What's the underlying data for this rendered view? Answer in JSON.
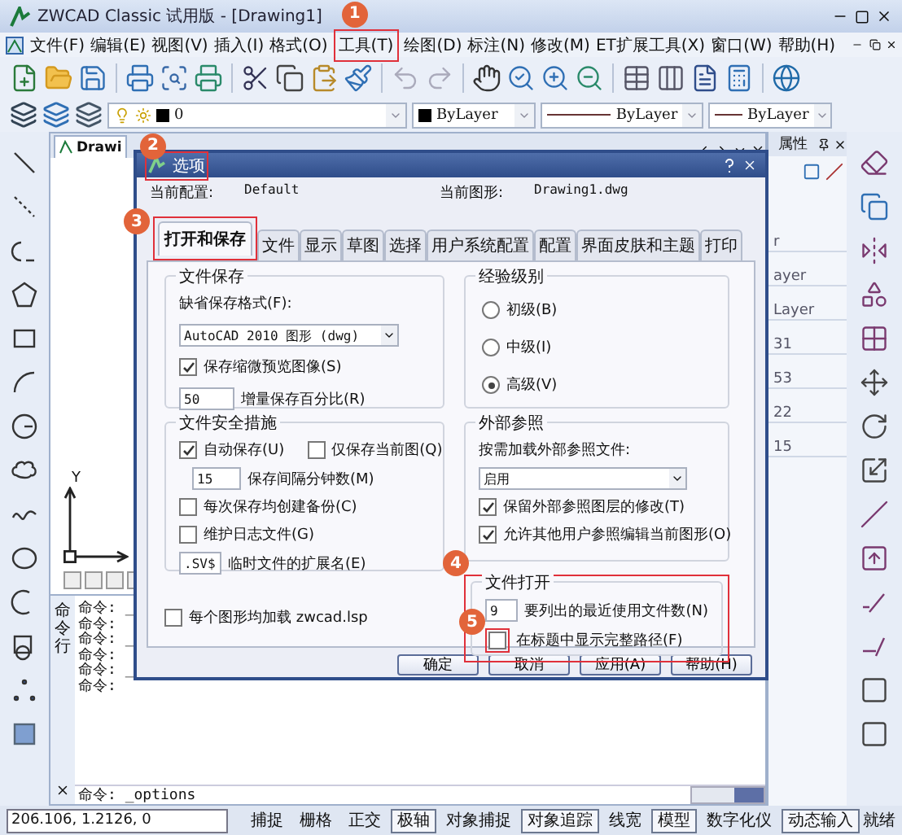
{
  "window": {
    "title": "ZWCAD Classic 试用版 - [Drawing1]"
  },
  "menu": [
    {
      "label": "文件(F)"
    },
    {
      "label": "编辑(E)"
    },
    {
      "label": "视图(V)"
    },
    {
      "label": "插入(I)"
    },
    {
      "label": "格式(O)"
    },
    {
      "label": "工具(T)",
      "callout": "1"
    },
    {
      "label": "绘图(D)"
    },
    {
      "label": "标注(N)"
    },
    {
      "label": "修改(M)"
    },
    {
      "label": "ET扩展工具(X)"
    },
    {
      "label": "窗口(W)"
    },
    {
      "label": "帮助(H)"
    }
  ],
  "layer_toolbar": {
    "layer": "0",
    "color_setting": "ByLayer",
    "linetype": "ByLayer",
    "lineweight": "ByLayer"
  },
  "drawing": {
    "tab": "Drawi",
    "axis_label": "Y",
    "command_label": "命令行",
    "history": [
      "命令: _",
      "命令:",
      "命令: _",
      "命令:",
      "命令: _",
      "命令:"
    ],
    "command": "命令: _options"
  },
  "properties": {
    "title": "属性",
    "rows": [
      "r",
      "ayer",
      "Layer",
      "31",
      "53",
      "22",
      "15"
    ]
  },
  "dialog": {
    "title": "选项",
    "callout": "2",
    "profile_label": "当前配置:",
    "profile": "Default",
    "drawing_label": "当前图形:",
    "drawing": "Drawing1.dwg",
    "tabs": [
      {
        "label": "打开和保存",
        "selected": true,
        "callout": "3"
      },
      {
        "label": "文件",
        "selected": false
      },
      {
        "label": "显示",
        "selected": false
      },
      {
        "label": "草图",
        "selected": false
      },
      {
        "label": "选择",
        "selected": false
      },
      {
        "label": "用户系统配置",
        "selected": false
      },
      {
        "label": "配置",
        "selected": false
      },
      {
        "label": "界面皮肤和主题",
        "selected": false
      },
      {
        "label": "打印",
        "selected": false
      }
    ],
    "file_save": {
      "title": "文件保存",
      "format_label": "缺省保存格式(F):",
      "format": "AutoCAD 2010 图形 (dwg)",
      "thumbnail": {
        "label": "保存缩微预览图像(S)",
        "checked": true
      },
      "increment": {
        "value": "50",
        "label": "增量保存百分比(R)"
      }
    },
    "experience": {
      "title": "经验级别",
      "options": [
        {
          "label": "初级(B)",
          "selected": false
        },
        {
          "label": "中级(I)",
          "selected": false
        },
        {
          "label": "高级(V)",
          "selected": true
        }
      ]
    },
    "safety": {
      "title": "文件安全措施",
      "autosave": {
        "label": "自动保存(U)",
        "checked": true
      },
      "current_only": {
        "label": "仅保存当前图(Q)",
        "checked": false
      },
      "interval": {
        "value": "15",
        "label": "保存间隔分钟数(M)"
      },
      "backup": {
        "label": "每次保存均创建备份(C)",
        "checked": false
      },
      "log": {
        "label": "维护日志文件(G)",
        "checked": false
      },
      "extension": {
        "value": ".SV$",
        "label": "临时文件的扩展名(E)"
      }
    },
    "xref": {
      "title": "外部参照",
      "load_label": "按需加载外部参照文件:",
      "load": "启用",
      "checks": [
        {
          "label": "保留外部参照图层的修改(T)",
          "checked": true
        },
        {
          "label": "允许其他用户参照编辑当前图形(O)",
          "checked": true
        }
      ]
    },
    "lsp": {
      "label": "每个图形均加载 zwcad.lsp",
      "checked": false
    },
    "file_open": {
      "title": "文件打开",
      "callout": "4",
      "recent": {
        "value": "9",
        "label": "要列出的最近使用文件数(N)"
      },
      "full_path": {
        "label": "在标题中显示完整路径(F)",
        "checked": false,
        "callout": "5"
      }
    },
    "buttons": [
      "确定",
      "取消",
      "应用(A)",
      "帮助(H)"
    ]
  },
  "status_bar": {
    "coords": "206.106,  1.2126,  0",
    "toggles": [
      {
        "label": "捕捉",
        "on": false
      },
      {
        "label": "栅格",
        "on": false
      },
      {
        "label": "正交",
        "on": false
      },
      {
        "label": "极轴",
        "on": true
      },
      {
        "label": "对象捕捉",
        "on": false
      },
      {
        "label": "对象追踪",
        "on": true
      },
      {
        "label": "线宽",
        "on": false
      },
      {
        "label": "模型",
        "on": true
      },
      {
        "label": "数字化仪",
        "on": false
      },
      {
        "label": "动态输入",
        "on": true
      }
    ],
    "state": "就绪"
  }
}
